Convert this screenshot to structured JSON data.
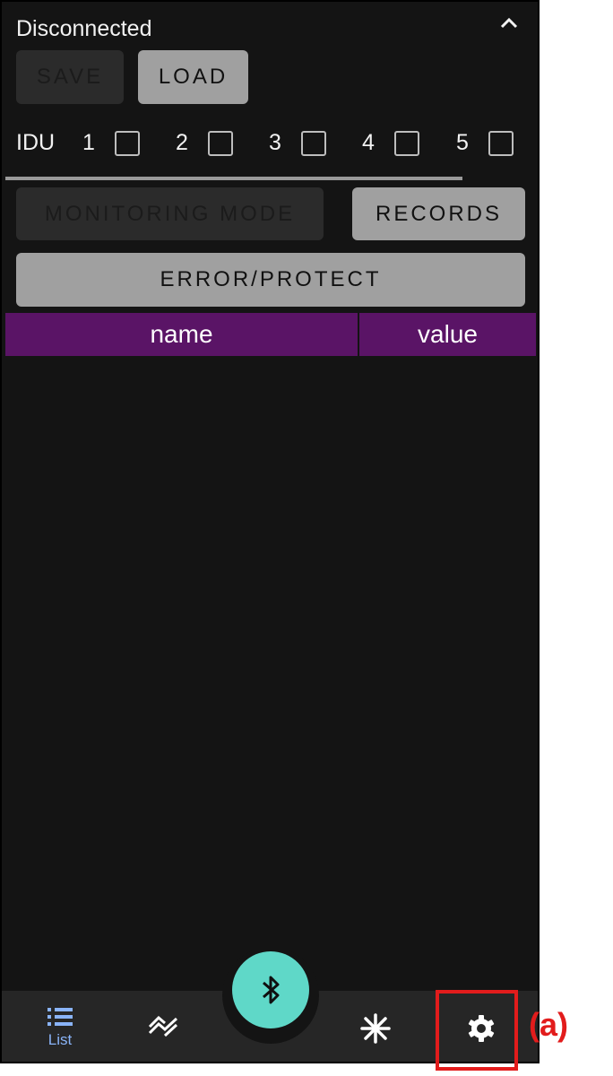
{
  "header": {
    "status": "Disconnected",
    "collapse_icon": "chevron-up-icon"
  },
  "file_buttons": {
    "save": "SAVE",
    "load": "LOAD"
  },
  "idu": {
    "label": "IDU",
    "units": [
      "1",
      "2",
      "3",
      "4",
      "5"
    ]
  },
  "mode_buttons": {
    "monitoring": "MONITORING MODE",
    "records": "RECORDS",
    "error": "ERROR/PROTECT"
  },
  "table": {
    "columns": [
      "name",
      "value"
    ],
    "rows": []
  },
  "bottom_nav": {
    "items": [
      {
        "icon": "list-icon",
        "label": "List",
        "active": true
      },
      {
        "icon": "trend-icon",
        "label": ""
      },
      {
        "icon": "bluetooth-icon",
        "label": ""
      },
      {
        "icon": "snowflake-icon",
        "label": ""
      },
      {
        "icon": "settings-icon",
        "label": ""
      }
    ]
  },
  "annotation": {
    "label": "(a)"
  },
  "colors": {
    "background": "#141414",
    "header": "#5a1466",
    "fab": "#5fd8c8",
    "active_nav": "#8ab4f8",
    "annotation": "#e21c1c"
  }
}
